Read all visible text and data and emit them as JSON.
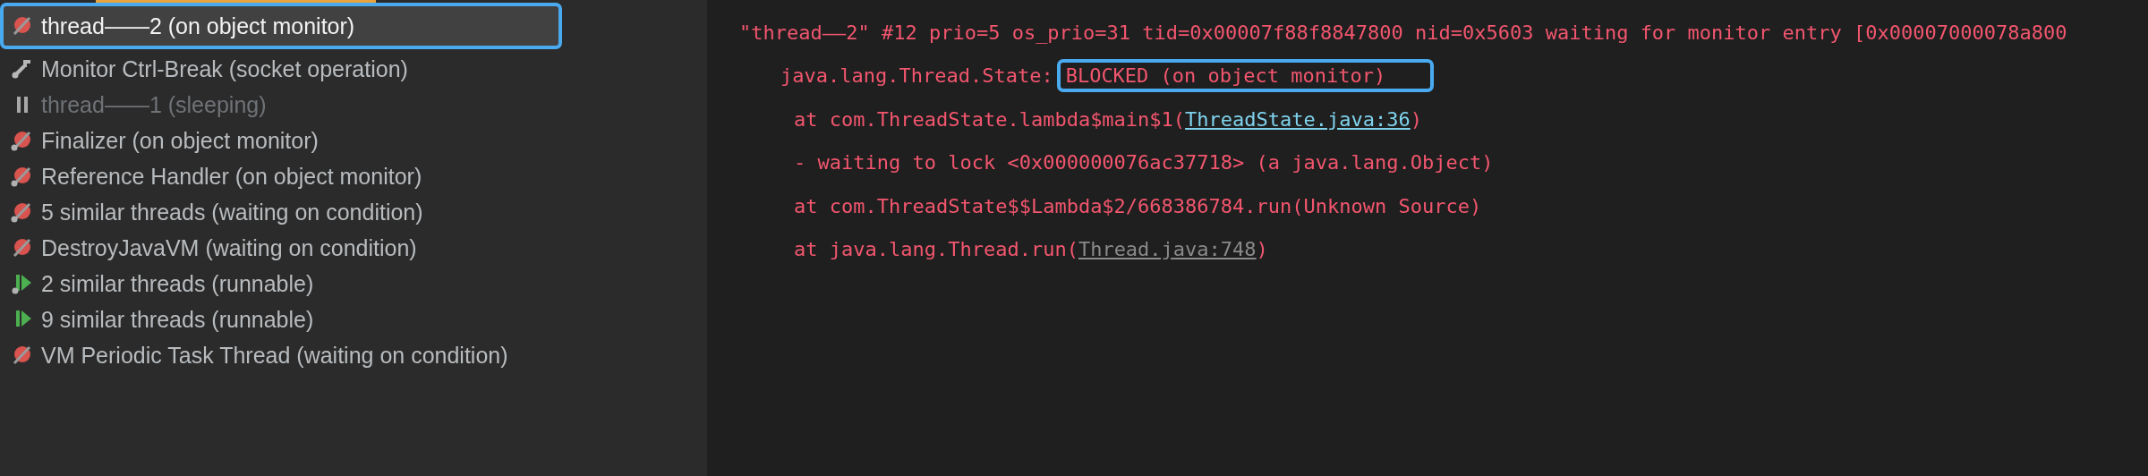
{
  "threads": [
    {
      "label": "thread——2 (on object monitor)",
      "kind": "monitor",
      "dot": false,
      "selected": true,
      "dimmed": false
    },
    {
      "label": "Monitor Ctrl-Break (socket operation)",
      "kind": "socket",
      "dot": false,
      "selected": false,
      "dimmed": false
    },
    {
      "label": "thread——1 (sleeping)",
      "kind": "sleeping",
      "dot": false,
      "selected": false,
      "dimmed": true
    },
    {
      "label": "Finalizer (on object monitor)",
      "kind": "monitor",
      "dot": true,
      "selected": false,
      "dimmed": false
    },
    {
      "label": "Reference Handler (on object monitor)",
      "kind": "monitor",
      "dot": true,
      "selected": false,
      "dimmed": false
    },
    {
      "label": "5 similar threads (waiting on condition)",
      "kind": "monitor",
      "dot": true,
      "selected": false,
      "dimmed": false
    },
    {
      "label": "DestroyJavaVM (waiting on condition)",
      "kind": "monitor",
      "dot": false,
      "selected": false,
      "dimmed": false
    },
    {
      "label": "2 similar threads (runnable)",
      "kind": "runnable",
      "dot": true,
      "selected": false,
      "dimmed": false
    },
    {
      "label": "9 similar threads (runnable)",
      "kind": "runnable",
      "dot": false,
      "selected": false,
      "dimmed": false
    },
    {
      "label": "VM Periodic Task Thread (waiting on condition)",
      "kind": "monitor",
      "dot": false,
      "selected": false,
      "dimmed": false
    }
  ],
  "dump": [
    {
      "kind": "header",
      "segments": [
        {
          "kind": "text",
          "text": "\"thread——2\" #12 prio=5 os_prio=31 tid=0x00007f88f8847800 nid=0x5603 waiting for monitor entry [0x00007000078a800"
        }
      ]
    },
    {
      "kind": "state",
      "segments": [
        {
          "kind": "text",
          "text": "java.lang.Thread.State:"
        },
        {
          "kind": "boxed",
          "text": "BLOCKED (on object monitor)"
        }
      ]
    },
    {
      "kind": "frame",
      "segments": [
        {
          "kind": "text",
          "text": "at com.ThreadState.lambda$main$1("
        },
        {
          "kind": "link",
          "text": "ThreadState.java:36"
        },
        {
          "kind": "text",
          "text": ")"
        }
      ]
    },
    {
      "kind": "frame",
      "segments": [
        {
          "kind": "text",
          "text": "- waiting to lock <0x000000076ac37718> (a java.lang.Object)"
        }
      ]
    },
    {
      "kind": "frame",
      "segments": [
        {
          "kind": "text",
          "text": "at com.ThreadState$$Lambda$2/668386784.run(Unknown Source)"
        }
      ]
    },
    {
      "kind": "frame",
      "segments": [
        {
          "kind": "text",
          "text": "at java.lang.Thread.run("
        },
        {
          "kind": "dimlink",
          "text": "Thread.java:748"
        },
        {
          "kind": "text",
          "text": ")"
        }
      ]
    }
  ]
}
